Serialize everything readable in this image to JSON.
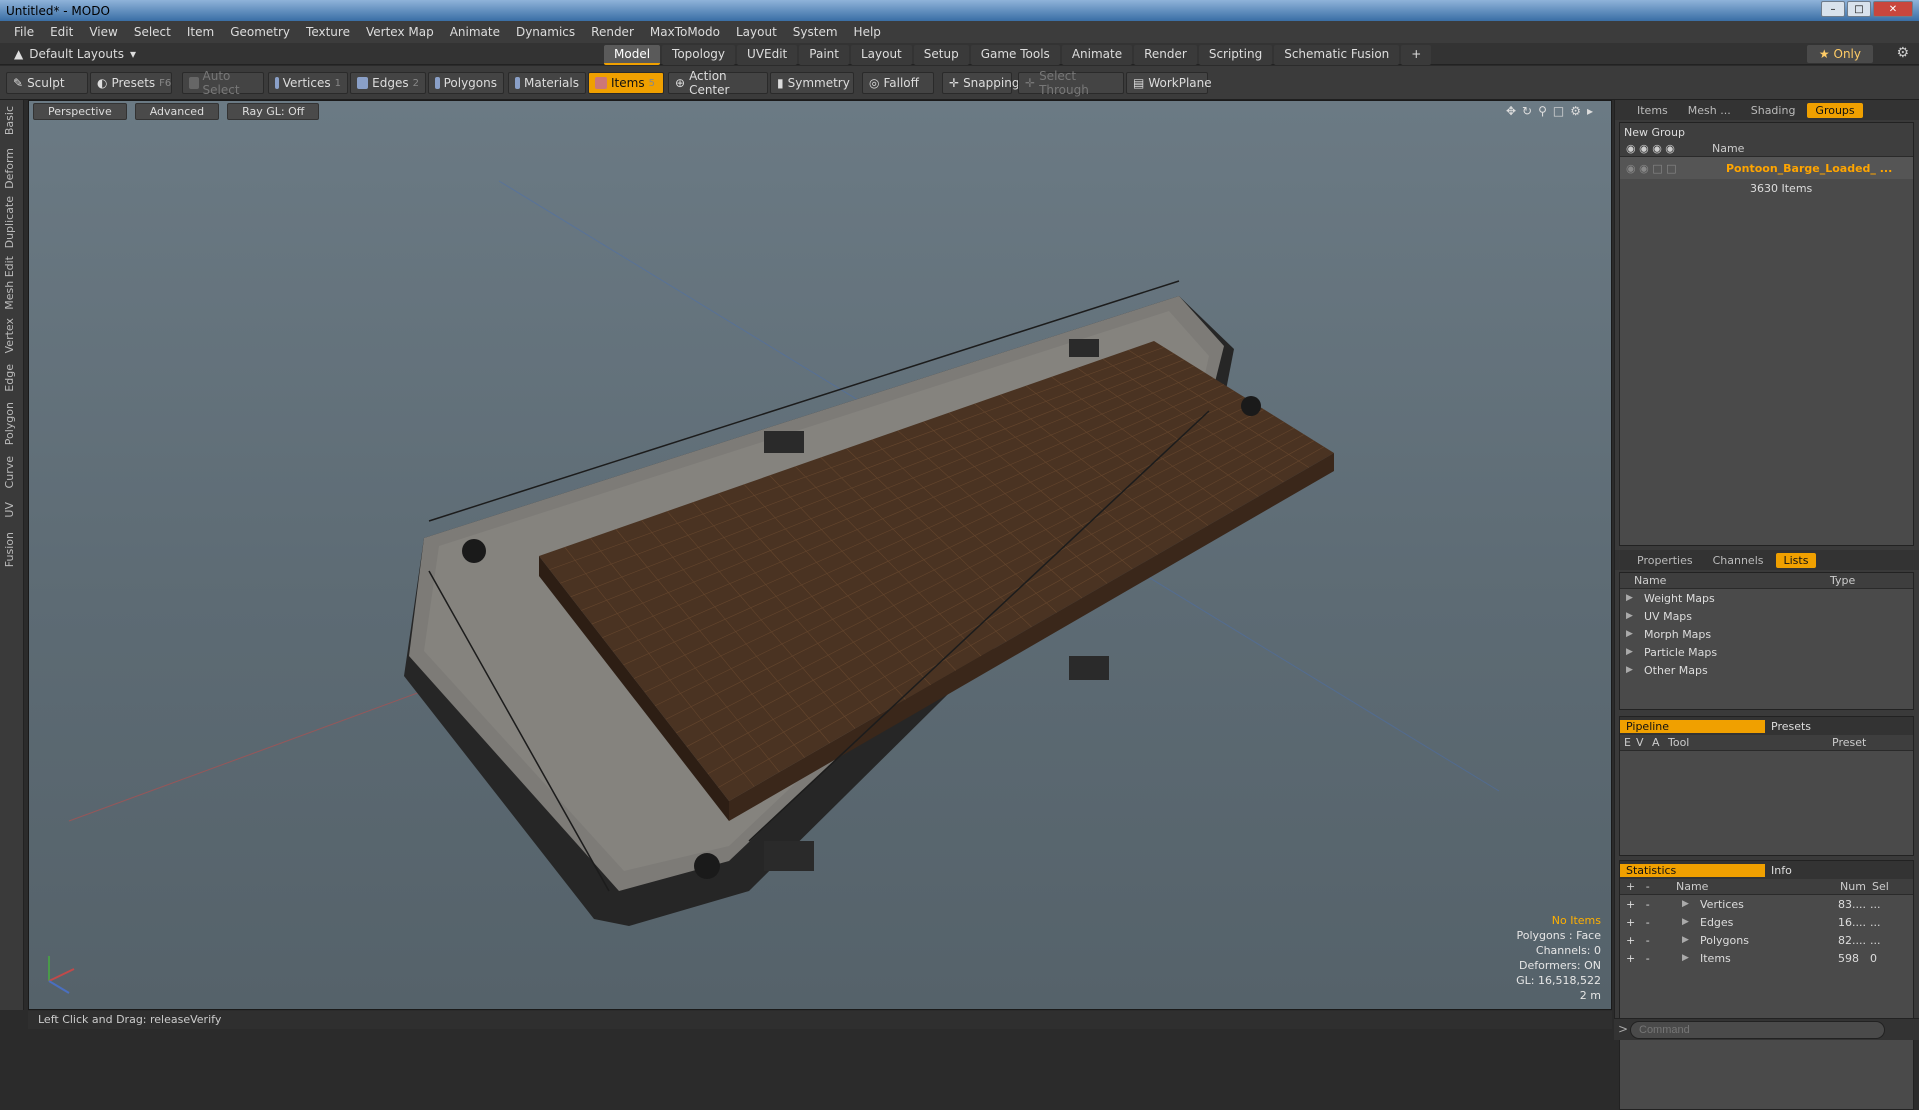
{
  "window": {
    "title": "Untitled* - MODO"
  },
  "menu": [
    "File",
    "Edit",
    "View",
    "Select",
    "Item",
    "Geometry",
    "Texture",
    "Vertex Map",
    "Animate",
    "Dynamics",
    "Render",
    "MaxToModo",
    "Layout",
    "System",
    "Help"
  ],
  "layoutbar": {
    "layout_label": "Default Layouts",
    "tabs": [
      "Model",
      "Topology",
      "UVEdit",
      "Paint",
      "Layout",
      "Setup",
      "Game Tools",
      "Animate",
      "Render",
      "Scripting",
      "Schematic Fusion"
    ],
    "active_tab": "Model",
    "only_label": "Only"
  },
  "toolbar": {
    "sculpt": "Sculpt",
    "presets": "Presets",
    "presets_key": "F6",
    "auto_select": "Auto Select",
    "vertices": "Vertices",
    "vertices_key": "1",
    "edges": "Edges",
    "edges_key": "2",
    "polygons": "Polygons",
    "materials": "Materials",
    "items": "Items",
    "items_key": "5",
    "action_center": "Action Center",
    "symmetry": "Symmetry",
    "falloff": "Falloff",
    "snapping": "Snapping",
    "select_through": "Select Through",
    "workplane": "WorkPlane"
  },
  "left_tabs": [
    "Basic",
    "Deform",
    "Duplicate",
    "Mesh Edit",
    "Vertex",
    "Edge",
    "Polygon",
    "Curve",
    "UV",
    "Fusion"
  ],
  "viewport": {
    "perspective": "Perspective",
    "advanced": "Advanced",
    "raygl": "Ray GL: Off",
    "stats": {
      "no_items": "No Items",
      "polygons": "Polygons : Face",
      "channels": "Channels: 0",
      "deformers": "Deformers: ON",
      "gl": "GL: 16,518,522",
      "scale": "2 m"
    }
  },
  "status_bar": {
    "text": "Left Click and Drag:   releaseVerify"
  },
  "groups_panel": {
    "tabs": [
      "Items",
      "Mesh ...",
      "Shading",
      "Groups"
    ],
    "active_tab": "Groups",
    "new_group": "New Group",
    "name_header": "Name",
    "group_name": "Pontoon_Barge_Loaded_ ...",
    "group_count": "3630 Items"
  },
  "lists_panel": {
    "tabs": [
      "Properties",
      "Channels",
      "Lists"
    ],
    "active_tab": "Lists",
    "name_header": "Name",
    "type_header": "Type",
    "items": [
      "Weight Maps",
      "UV Maps",
      "Morph Maps",
      "Particle Maps",
      "Other Maps"
    ]
  },
  "pipeline_panel": {
    "tabs": [
      "Pipeline",
      "Presets"
    ],
    "headers": {
      "e": "E",
      "v": "V",
      "a": "A",
      "tool": "Tool",
      "preset": "Preset"
    }
  },
  "statistics_panel": {
    "tabs": [
      "Statistics",
      "Info"
    ],
    "headers": {
      "name": "Name",
      "num": "Num",
      "sel": "Sel"
    },
    "rows": [
      {
        "name": "Vertices",
        "num": "83....",
        "sel": "..."
      },
      {
        "name": "Edges",
        "num": "16....",
        "sel": "..."
      },
      {
        "name": "Polygons",
        "num": "82....",
        "sel": "..."
      },
      {
        "name": "Items",
        "num": "598",
        "sel": "0"
      }
    ]
  },
  "command": {
    "placeholder": "Command"
  },
  "colors": {
    "accent": "#f0a000",
    "viewport_bg": "#5f6d76"
  }
}
